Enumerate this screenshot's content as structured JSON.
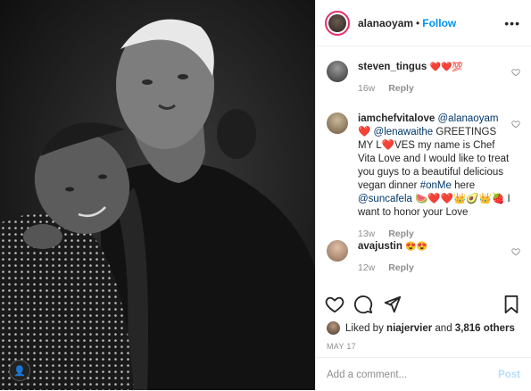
{
  "header": {
    "username": "alanaoyam",
    "separator": "•",
    "follow_label": "Follow",
    "more_icon": "more-options-icon"
  },
  "comments": [
    {
      "username": "steven_tingus",
      "text": "❤️❤️💯",
      "age": "16w",
      "reply_label": "Reply"
    },
    {
      "username": "iamchefvitalove",
      "segments": [
        {
          "text": "@alanaoyam",
          "mention": true
        },
        {
          "text": " ❤️ ",
          "mention": false
        },
        {
          "text": "@lenawaithe",
          "mention": true
        },
        {
          "text": " GREETINGS MY L❤️VES my name is Chef Vita Love and I would like to treat you guys to a beautiful delicious vegan dinner ",
          "mention": false
        },
        {
          "text": "#onMe",
          "mention": true
        },
        {
          "text": " here ",
          "mention": false
        },
        {
          "text": "@suncafela",
          "mention": true
        },
        {
          "text": " 🍉❤️❤️👑🥑👑🍓 I want to honor your Love",
          "mention": false
        }
      ],
      "age": "13w",
      "reply_label": "Reply"
    },
    {
      "username": "avajustin",
      "text": "😍😍",
      "age": "12w",
      "reply_label": "Reply"
    }
  ],
  "likes": {
    "prefix": "Liked by",
    "user": "niajervier",
    "and": "and",
    "others": "3,816 others"
  },
  "date": "MAY 17",
  "add_comment": {
    "placeholder": "Add a comment...",
    "post_label": "Post"
  },
  "colors": {
    "link": "#0095f6",
    "mention": "#00376b",
    "muted": "#8e8e8e",
    "post_disabled": "#b2dffc",
    "story_ring": "#e1306c"
  }
}
